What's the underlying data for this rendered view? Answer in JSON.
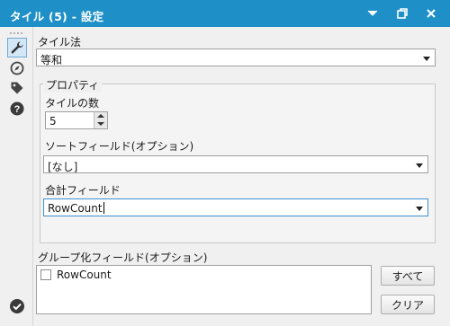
{
  "window": {
    "title": "タイル (5) - 設定",
    "accent_color": "#1e8fc7",
    "controls": [
      "chevron-down-icon",
      "restore-icon",
      "close-icon"
    ]
  },
  "toolbar": {
    "tools": [
      "wrench-icon",
      "compass-icon",
      "tag-icon",
      "help-icon"
    ],
    "active": "wrench-icon",
    "status": "check-circle-icon"
  },
  "tile_method": {
    "label": "タイル法",
    "value": "等和"
  },
  "properties": {
    "title": "プロパティ",
    "tile_count_label": "タイルの数",
    "tile_count_value": "5",
    "sort_field_label": "ソートフィールド(オプション)",
    "sort_field_value": "[なし]",
    "sum_field_label": "合計フィールド",
    "sum_field_value": "RowCount"
  },
  "grouping": {
    "label": "グループ化フィールド(オプション)",
    "items": [
      {
        "label": "RowCount",
        "checked": false
      }
    ],
    "all_button": "すべて",
    "clear_button": "クリア"
  }
}
